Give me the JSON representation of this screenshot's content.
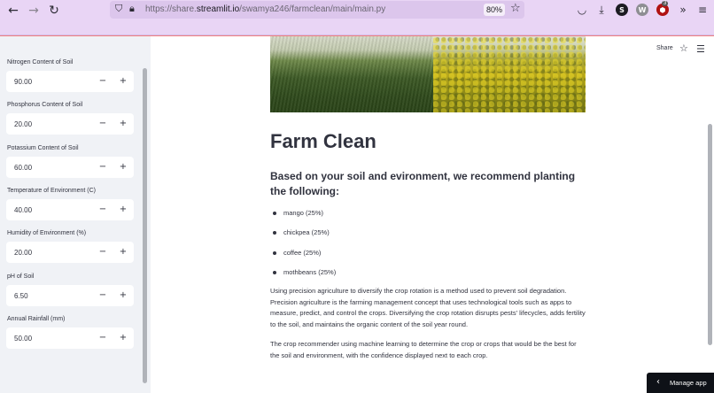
{
  "browser": {
    "back_glyph": "←",
    "forward_glyph": "→",
    "reload_glyph": "↻",
    "url_prefix": "https://share.",
    "url_domain": "streamlit.io",
    "url_path": "/swamya246/farmclean/main/main.py",
    "zoom": "80%",
    "extension_s": "S",
    "extension_w": "W",
    "extension_badge": "3",
    "icons": [
      "shield-icon",
      "lock-icon",
      "star-icon",
      "pocket-icon",
      "download-icon",
      "extension-icon",
      "chevrons-right-icon",
      "menu-icon"
    ]
  },
  "sidebar": {
    "fields": [
      {
        "label": "Nitrogen Content of Soil",
        "value": "90.00"
      },
      {
        "label": "Phosphorus Content of Soil",
        "value": "20.00"
      },
      {
        "label": "Potassium Content of Soil",
        "value": "60.00"
      },
      {
        "label": "Temperature of Environment (C)",
        "value": "40.00"
      },
      {
        "label": "Humidity of Environment (%)",
        "value": "20.00"
      },
      {
        "label": "pH of Soil",
        "value": "6.50"
      },
      {
        "label": "Annual Rainfall (mm)",
        "value": "50.00"
      }
    ],
    "minus": "−",
    "plus": "+"
  },
  "header": {
    "share_label": "Share"
  },
  "main": {
    "title": "Farm Clean",
    "subheading": "Based on your soil and evironment, we recommend planting the following:",
    "recommendations": [
      "mango (25%)",
      "chickpea (25%)",
      "coffee (25%)",
      "mothbeans (25%)"
    ],
    "paragraph1": "Using precision agriculture to diversify the crop rotation is a method used to prevent soil degradation. Precision agriculture is the farming management concept that uses technological tools such as apps to measure, predict, and control the crops. Diversifying the crop rotation disrupts pests' lifecycles, adds fertility to the soil, and maintains the organic content of the soil year round.",
    "paragraph2": "The crop recommender using machine learning to determine the crop or crops that would be the best for the soil and environment, with the confidence displayed next to each crop."
  },
  "manage_app": {
    "label": "Manage app",
    "chevron": "‹"
  }
}
